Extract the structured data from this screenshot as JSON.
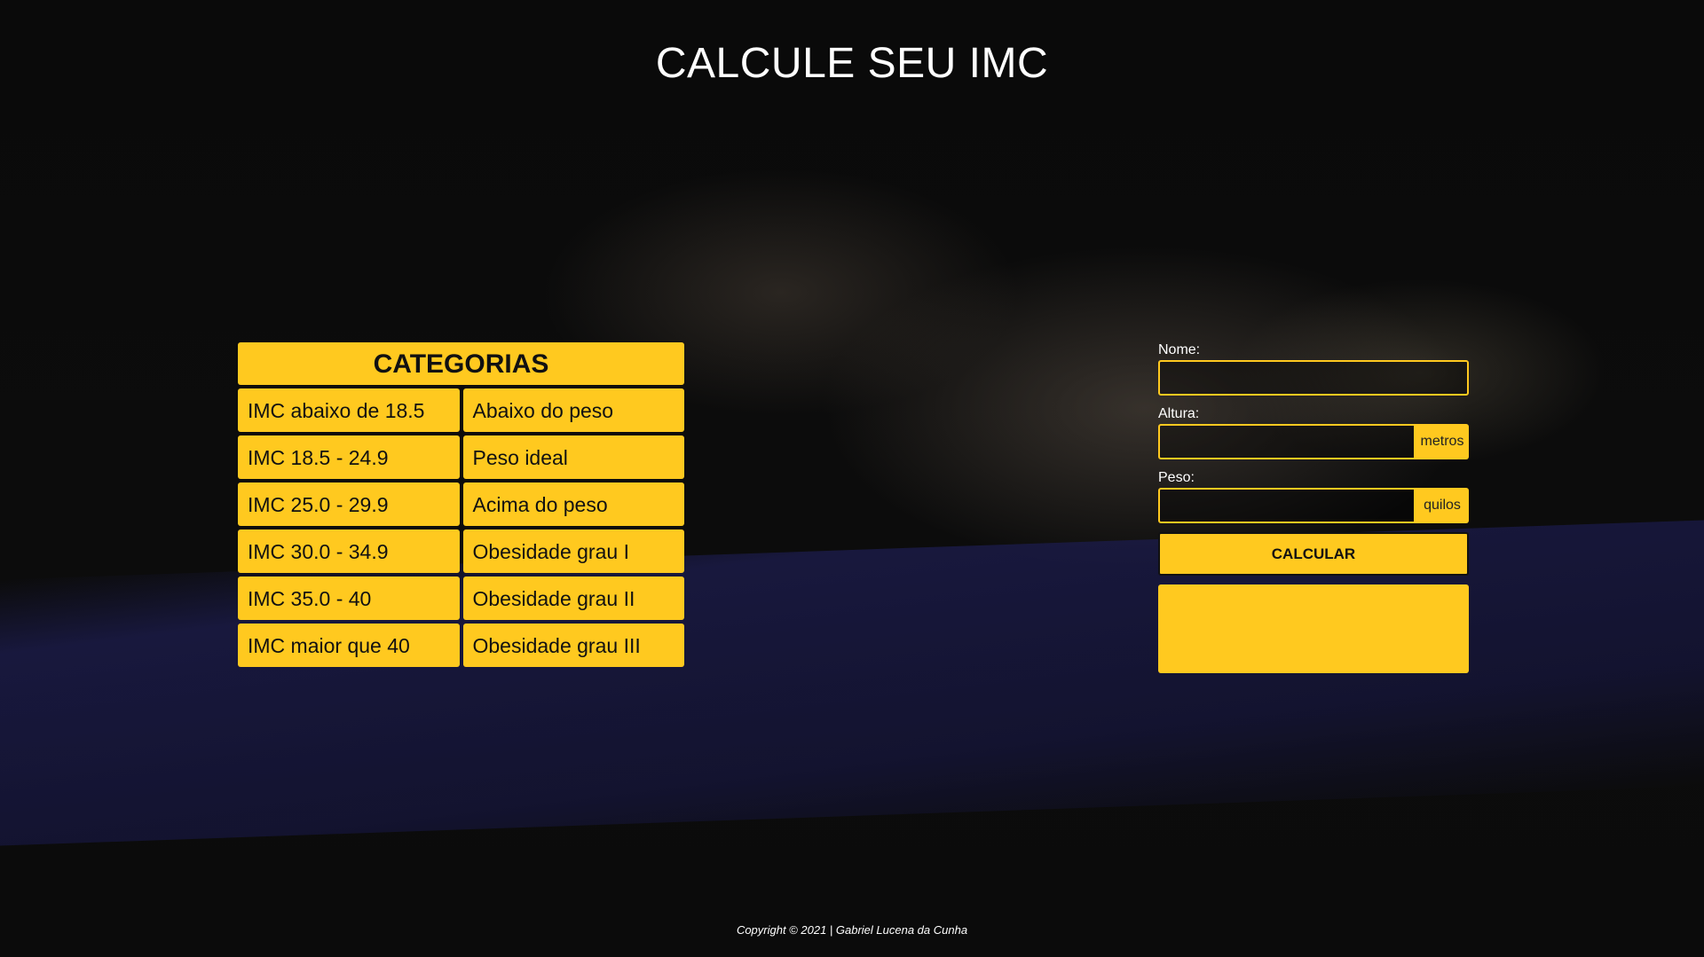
{
  "header": {
    "title": "CALCULE SEU IMC"
  },
  "categories": {
    "title": "CATEGORIAS",
    "rows": [
      {
        "range": "IMC abaixo de 18.5",
        "label": "Abaixo do peso"
      },
      {
        "range": "IMC 18.5 - 24.9",
        "label": "Peso ideal"
      },
      {
        "range": "IMC 25.0 - 29.9",
        "label": "Acima do peso"
      },
      {
        "range": "IMC 30.0 - 34.9",
        "label": "Obesidade grau I"
      },
      {
        "range": "IMC 35.0 - 40",
        "label": "Obesidade grau II"
      },
      {
        "range": "IMC maior que 40",
        "label": "Obesidade grau III"
      }
    ]
  },
  "form": {
    "nome_label": "Nome:",
    "nome_value": "",
    "altura_label": "Altura:",
    "altura_value": "",
    "altura_unit": "metros",
    "peso_label": "Peso:",
    "peso_value": "",
    "peso_unit": "quilos",
    "calcular_label": "CALCULAR",
    "result_text": ""
  },
  "footer": {
    "copyright": "Copyright © 2021 | Gabriel Lucena da Cunha"
  },
  "colors": {
    "accent": "#ffc91f",
    "background": "#0b0b0b",
    "text_dark": "#111111"
  }
}
